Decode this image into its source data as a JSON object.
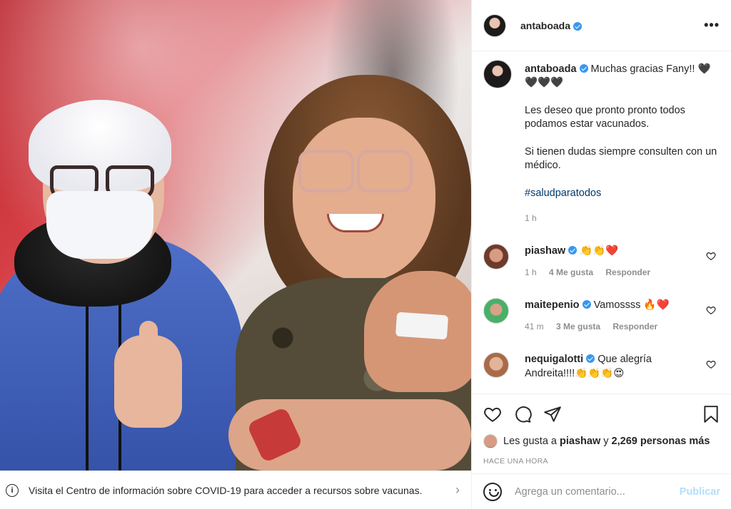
{
  "post": {
    "author": "antaboada",
    "photo_alt": "Two women posing after vaccination"
  },
  "covid_banner": {
    "text": "Visita el Centro de información sobre COVID-19 para acceder a recursos sobre vacunas.",
    "info_icon": "i"
  },
  "caption": {
    "author": "antaboada",
    "line1": "Muchas gracias Fany!! 🖤 🖤🖤🖤",
    "para2": "Les deseo que pronto pronto todos podamos estar vacunados.",
    "para3": "Si tienen dudas siempre consulten con un médico.",
    "hashtag": "#saludparatodos",
    "time": "1 h"
  },
  "comments": [
    {
      "user": "piashaw",
      "text": "👏👏❤️",
      "time": "1 h",
      "likes": "4 Me gusta",
      "reply": "Responder"
    },
    {
      "user": "maitepenio",
      "text": "Vamossss 🔥❤️",
      "time": "41 m",
      "likes": "3 Me gusta",
      "reply": "Responder"
    },
    {
      "user": "nequigalotti",
      "text": "Que alegría Andreita!!!!👏👏👏😍",
      "time": "",
      "likes": "",
      "reply": ""
    }
  ],
  "likes": {
    "prefix": "Les gusta a",
    "user": "piashaw",
    "connector": "y",
    "count": "2,269 personas más"
  },
  "time_ago": "HACE UNA HORA",
  "add_comment": {
    "placeholder": "Agrega un comentario...",
    "publish": "Publicar"
  },
  "colors": {
    "verified": "#3897f0",
    "publish_disabled": "#b2dffc",
    "hashtag": "#00376b",
    "secondary_text": "#8e8e8e"
  }
}
